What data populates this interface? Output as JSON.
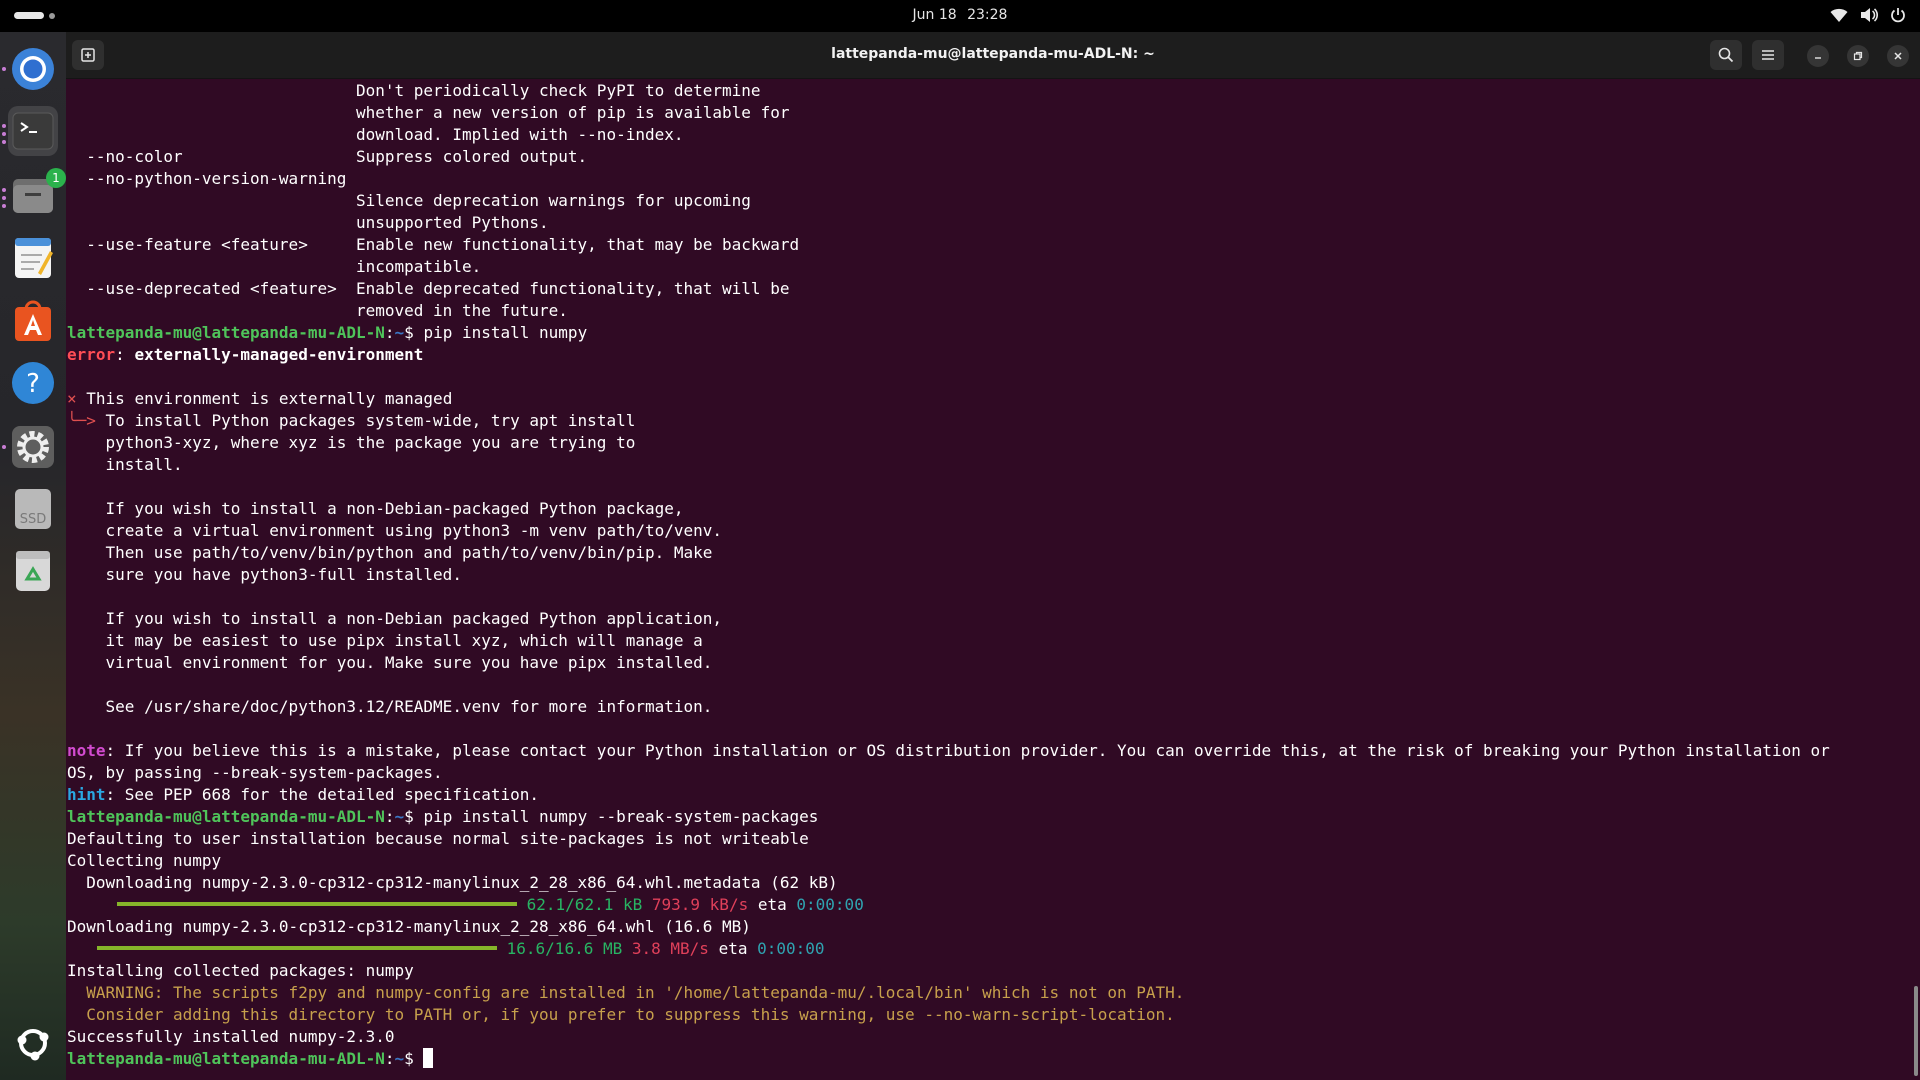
{
  "topbar": {
    "date": "Jun 18",
    "time": "23:28"
  },
  "window": {
    "title": "lattepanda-mu@lattepanda-mu-ADL-N: ~"
  },
  "dock": {
    "files_badge": "1",
    "ssd_label": "SSD"
  },
  "terminal": {
    "prompt_user": "lattepanda-mu@lattepanda-mu-ADL-N",
    "prompt_path": "~",
    "help": [
      "                              Don't periodically check PyPI to determine",
      "                              whether a new version of pip is available for",
      "                              download. Implied with --no-index.",
      "  --no-color                  Suppress colored output.",
      "  --no-python-version-warning",
      "                              Silence deprecation warnings for upcoming",
      "                              unsupported Pythons.",
      "  --use-feature <feature>     Enable new functionality, that may be backward",
      "                              incompatible.",
      "  --use-deprecated <feature>  Enable deprecated functionality, that will be",
      "                              removed in the future."
    ],
    "cmd1": "pip install numpy",
    "error_label": "error",
    "error_msg": "externally-managed-environment",
    "x_mark": "×",
    "managed_line": " This environment is externally managed",
    "arrow": "╰─>",
    "managed_details": [
      " To install Python packages system-wide, try apt install",
      "    python3-xyz, where xyz is the package you are trying to",
      "    install.",
      "",
      "    If you wish to install a non-Debian-packaged Python package,",
      "    create a virtual environment using python3 -m venv path/to/venv.",
      "    Then use path/to/venv/bin/python and path/to/venv/bin/pip. Make",
      "    sure you have python3-full installed.",
      "",
      "    If you wish to install a non-Debian packaged Python application,",
      "    it may be easiest to use pipx install xyz, which will manage a",
      "    virtual environment for you. Make sure you have pipx installed.",
      "",
      "    See /usr/share/doc/python3.12/README.venv for more information."
    ],
    "note_label": "note",
    "note_msg": ": If you believe this is a mistake, please contact your Python installation or OS distribution provider. You can override this, at the risk of breaking your Python installation or",
    "note_msg2": "OS, by passing --break-system-packages.",
    "hint_label": "hint",
    "hint_msg": ": See PEP 668 for the detailed specification.",
    "cmd2": "pip install numpy --break-system-packages",
    "default_user": "Defaulting to user installation because normal site-packages is not writeable",
    "collecting": "Collecting numpy",
    "dl_meta": "  Downloading numpy-2.3.0-cp312-cp312-manylinux_2_28_x86_64.whl.metadata (62 kB)",
    "prog1": {
      "size": "62.1/62.1 kB",
      "speed": "793.9 kB/s",
      "eta_label": "eta",
      "eta": "0:00:00",
      "fraction": 1.0
    },
    "dl_whl": "Downloading numpy-2.3.0-cp312-cp312-manylinux_2_28_x86_64.whl (16.6 MB)",
    "prog2": {
      "size": "16.6/16.6 MB",
      "speed": "3.8 MB/s",
      "eta_label": "eta",
      "eta": "0:00:00",
      "fraction": 1.0
    },
    "installing": "Installing collected packages: numpy",
    "warn1": "  WARNING: The scripts f2py and numpy-config are installed in '/home/lattepanda-mu/.local/bin' which is not on PATH.",
    "warn2": "  Consider adding this directory to PATH or, if you prefer to suppress this warning, use --no-warn-script-location.",
    "success": "Successfully installed numpy-2.3.0"
  },
  "colors": {
    "terminal_bg": "#300a24",
    "prompt": "#4fc45a",
    "error": "#ff4d55",
    "note": "#d24bd0",
    "hint": "#2aa7e2",
    "warning": "#c7a04c"
  },
  "icons": [
    "wifi-icon",
    "volume-icon",
    "power-icon",
    "new-tab-icon",
    "search-icon",
    "hamburger-menu-icon",
    "minimize-icon",
    "restore-icon",
    "close-icon"
  ]
}
